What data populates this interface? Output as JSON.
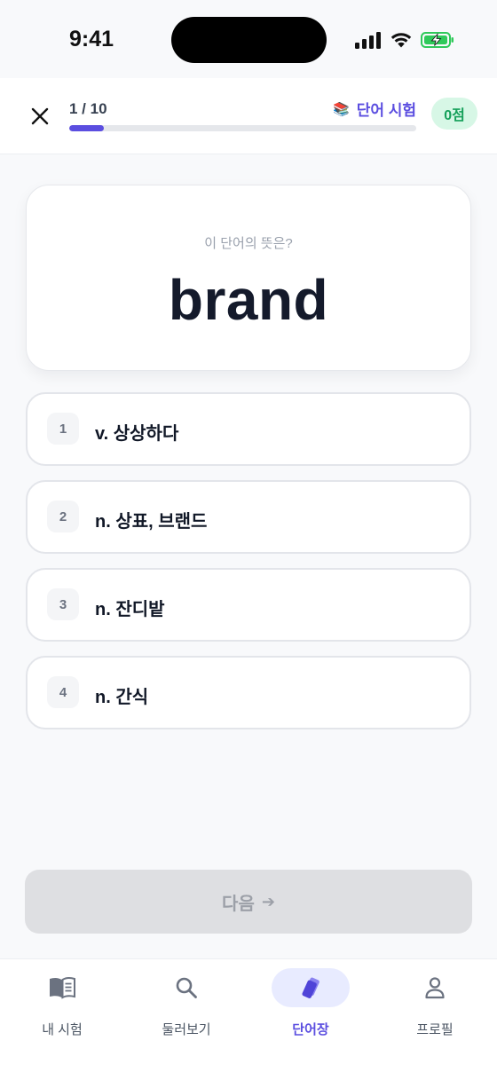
{
  "status_bar": {
    "time": "9:41"
  },
  "header": {
    "progress_text": "1 / 10",
    "progress_fraction": 0.1,
    "quiz_tag_emoji": "📚",
    "quiz_tag_label": "단어 시험",
    "score": "0점"
  },
  "question": {
    "prompt": "이 단어의 뜻은?",
    "word": "brand"
  },
  "options": [
    {
      "number": "1",
      "text": "v. 상상하다"
    },
    {
      "number": "2",
      "text": "n. 상표, 브랜드"
    },
    {
      "number": "3",
      "text": "n. 잔디밭"
    },
    {
      "number": "4",
      "text": "n. 간식"
    }
  ],
  "next_button": {
    "label": "다음",
    "arrow": "➔"
  },
  "tabs": [
    {
      "label": "내 시험",
      "icon": "book-icon",
      "active": false
    },
    {
      "label": "둘러보기",
      "icon": "search-icon",
      "active": false
    },
    {
      "label": "단어장",
      "icon": "cards-icon",
      "active": true
    },
    {
      "label": "프로필",
      "icon": "person-icon",
      "active": false
    }
  ],
  "colors": {
    "accent": "#5b4ee0",
    "score_bg": "#d7f7e6",
    "score_text": "#15a05a",
    "battery": "#2fc95a"
  }
}
